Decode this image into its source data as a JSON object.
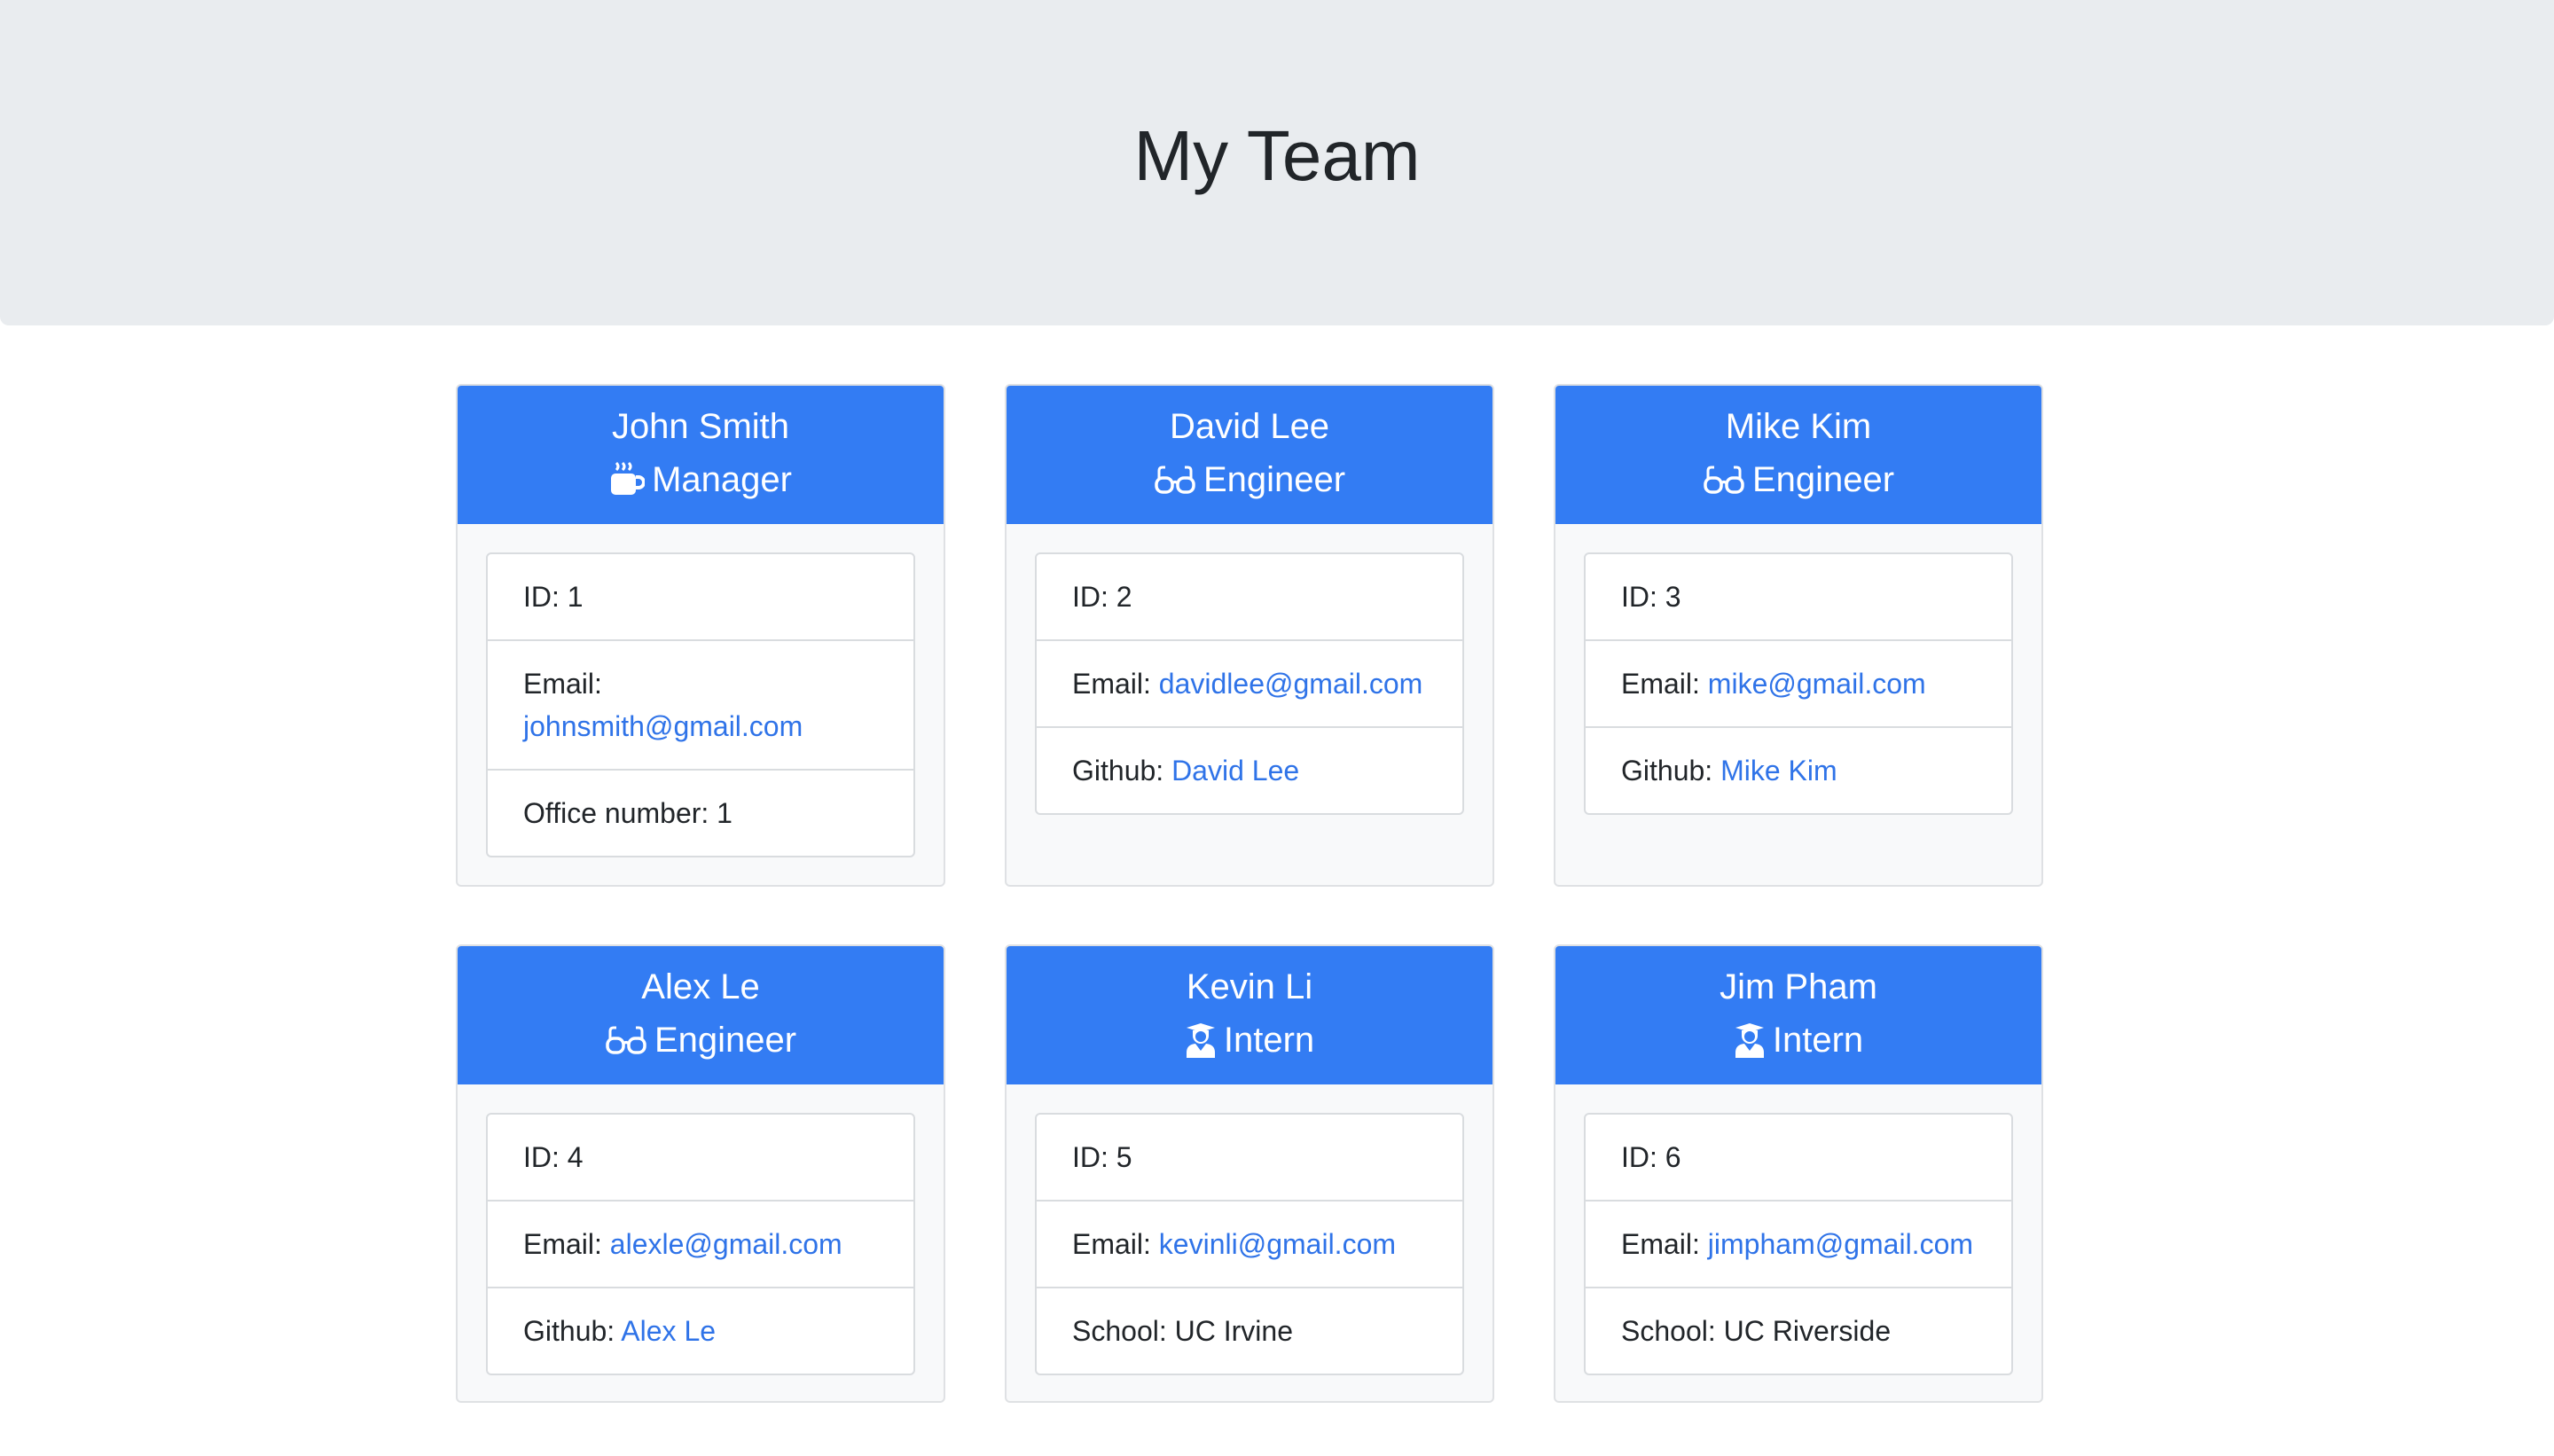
{
  "header": {
    "title": "My Team"
  },
  "colors": {
    "card_header": "#337cf3",
    "link": "#2f73e8",
    "jumbotron": "#e9ecef"
  },
  "employees": [
    {
      "name": "John Smith",
      "role": "Manager",
      "icon": "coffee-mug-icon",
      "id_label": "ID: 1",
      "email_label": "Email:",
      "email": "johnsmith@gmail.com",
      "extra_label": "Office number: 1"
    },
    {
      "name": "David Lee",
      "role": "Engineer",
      "icon": "glasses-icon",
      "id_label": "ID: 2",
      "email_label": "Email:",
      "email": "davidlee@gmail.com",
      "extra_prefix": "Github:",
      "extra_link": "David Lee"
    },
    {
      "name": "Mike Kim",
      "role": "Engineer",
      "icon": "glasses-icon",
      "id_label": "ID: 3",
      "email_label": "Email:",
      "email": "mike@gmail.com",
      "extra_prefix": "Github:",
      "extra_link": "Mike Kim"
    },
    {
      "name": "Alex Le",
      "role": "Engineer",
      "icon": "glasses-icon",
      "id_label": "ID: 4",
      "email_label": "Email:",
      "email": "alexle@gmail.com",
      "extra_prefix": "Github:",
      "extra_link": "Alex Le"
    },
    {
      "name": "Kevin Li",
      "role": "Intern",
      "icon": "graduate-icon",
      "id_label": "ID: 5",
      "email_label": "Email:",
      "email": "kevinli@gmail.com",
      "extra_label": "School: UC Irvine"
    },
    {
      "name": "Jim Pham",
      "role": "Intern",
      "icon": "graduate-icon",
      "id_label": "ID: 6",
      "email_label": "Email:",
      "email": "jimpham@gmail.com",
      "extra_label": "School: UC Riverside"
    }
  ]
}
